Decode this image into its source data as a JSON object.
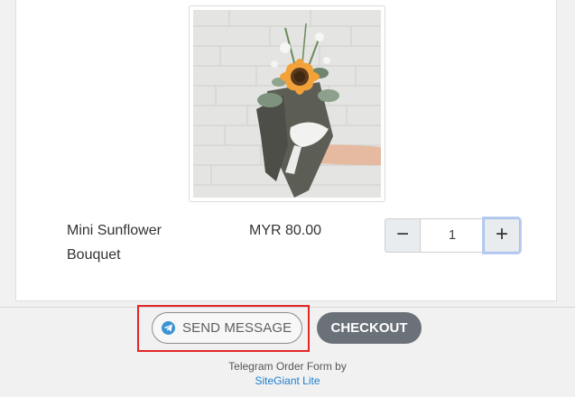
{
  "product": {
    "image_alt": "Mini Sunflower Bouquet photo",
    "name": "Mini Sunflower Bouquet",
    "price": "MYR 80.00",
    "quantity": "1"
  },
  "quantity_stepper": {
    "minus_label": "−",
    "plus_label": "+"
  },
  "actions": {
    "send_message_label": "SEND MESSAGE",
    "checkout_label": "CHECKOUT"
  },
  "footer": {
    "text": "Telegram Order Form by",
    "link_text": "SiteGiant Lite"
  },
  "colors": {
    "highlight": "#e32525",
    "telegram_blue": "#3b93d3",
    "checkout_bg": "#6b7179",
    "link": "#1e7fd1"
  },
  "icons": {
    "send_button_icon": "telegram-icon"
  }
}
